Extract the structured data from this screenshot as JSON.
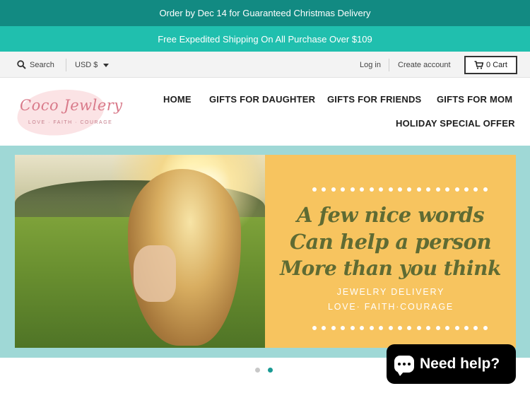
{
  "announcement": {
    "line1": "Order by Dec 14 for Guaranteed Christmas Delivery",
    "line2": "Free Expedited Shipping On All Purchase Over $109"
  },
  "utility": {
    "search_label": "Search",
    "currency": "USD $",
    "login": "Log in",
    "create_account": "Create account",
    "cart": "0 Cart"
  },
  "logo": {
    "title": "Coco Jewlery",
    "subtitle": "LOVE · FAITH · COURAGE"
  },
  "nav": [
    "HOME",
    "GIFTS FOR DAUGHTER",
    "GIFTS FOR FRIENDS",
    "GIFTS FOR MOM",
    "HOLIDAY SPECIAL OFFER"
  ],
  "hero": {
    "quote_lines": [
      "A few nice words",
      "Can help a person",
      "More than you think"
    ],
    "small_lines": [
      "JEWELRY DELIVERY",
      "LOVE· FAITH·COURAGE"
    ]
  },
  "slider": {
    "total": 2,
    "active": 2
  },
  "chat": {
    "label": "Need help?"
  },
  "colors": {
    "bar1": "#128a82",
    "bar2": "#20bfae",
    "hero_band": "#9fd8d6",
    "quote_bg": "#f7c45f",
    "quote_text": "#5f6b33",
    "dot_active": "#1a9a94",
    "dot_inactive": "#c8c8c8"
  }
}
